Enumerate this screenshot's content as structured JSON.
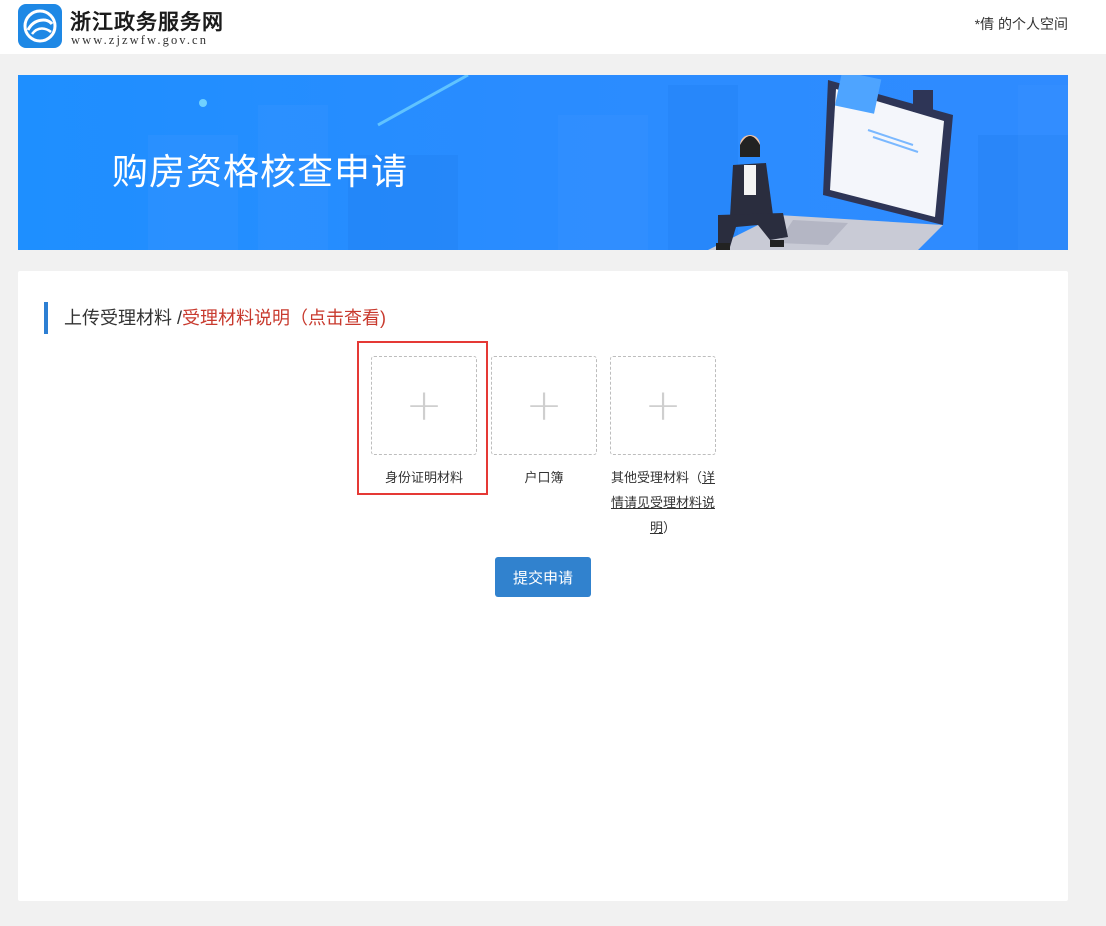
{
  "header": {
    "site_title": "浙江政务服务网",
    "site_url": "www.zjzwfw.gov.cn",
    "user_space": "*倩 的个人空间"
  },
  "banner": {
    "title": "购房资格核查申请"
  },
  "section": {
    "title": "上传受理材料 /",
    "explain_link": "受理材料说明（点击查看)"
  },
  "uploads": [
    {
      "label": "身份证明材料",
      "icon": "plus-icon"
    },
    {
      "label": "户口簿",
      "icon": "plus-icon"
    },
    {
      "label_prefix": "其他受理材料（",
      "label_link": "详情请见受理材料说明",
      "label_suffix": "）",
      "icon": "plus-icon"
    }
  ],
  "submit": {
    "label": "提交申请"
  },
  "colors": {
    "accent": "#3182ce",
    "banner_blue": "#2a8cff",
    "link_red": "#c83a2e",
    "highlight_red": "#e53935"
  }
}
